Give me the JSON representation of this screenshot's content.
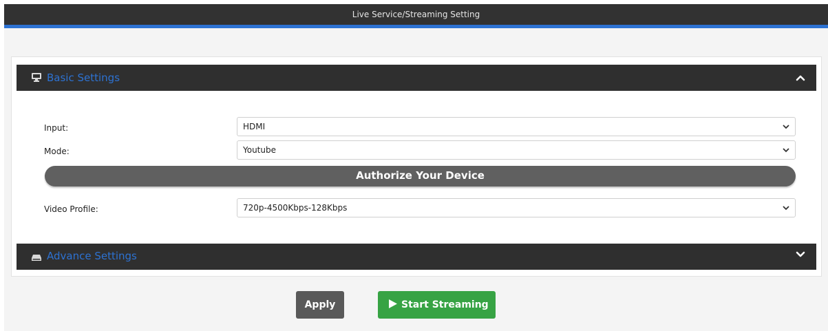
{
  "window": {
    "title": "Live Service/Streaming Setting",
    "accent_color": "#2d72d2"
  },
  "basic_settings": {
    "title": "Basic Settings",
    "icon": "monitor-icon",
    "expanded": true,
    "rows": {
      "input": {
        "label": "Input:",
        "value": "HDMI"
      },
      "mode": {
        "label": "Mode:",
        "value": "Youtube"
      },
      "video_profile": {
        "label": "Video Profile:",
        "value": "720p-4500Kbps-128Kbps"
      }
    },
    "authorize_label": "Authorize Your Device"
  },
  "advance_settings": {
    "title": "Advance Settings",
    "icon": "drive-icon",
    "expanded": false
  },
  "actions": {
    "apply_label": "Apply",
    "start_label": "Start Streaming",
    "start_color": "#37a344"
  }
}
